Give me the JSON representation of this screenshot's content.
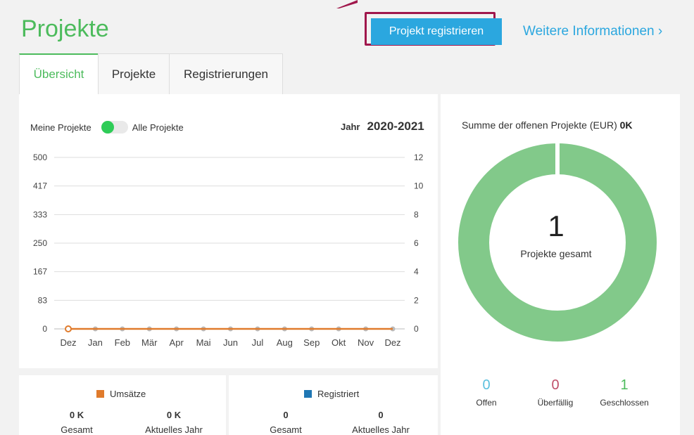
{
  "header": {
    "title": "Projekte",
    "primary_button": "Projekt registrieren",
    "more_link": "Weitere Informationen ›"
  },
  "tabs": [
    {
      "label": "Übersicht",
      "active": true
    },
    {
      "label": "Projekte",
      "active": false
    },
    {
      "label": "Registrierungen",
      "active": false
    }
  ],
  "overview": {
    "toggle_left": "Meine Projekte",
    "toggle_right": "Alle Projekte",
    "year_label": "Jahr",
    "year_value": "2020-2021"
  },
  "chart_data": {
    "type": "line",
    "categories": [
      "Dez",
      "Jan",
      "Feb",
      "Mär",
      "Apr",
      "Mai",
      "Jun",
      "Jul",
      "Aug",
      "Sep",
      "Okt",
      "Nov",
      "Dez"
    ],
    "y_left_ticks": [
      "500",
      "417",
      "333",
      "250",
      "167",
      "83",
      "0"
    ],
    "y_right_ticks": [
      "12",
      "10",
      "8",
      "6",
      "4",
      "2",
      "0"
    ],
    "ylim_left": [
      0,
      500
    ],
    "ylim_right": [
      0,
      12
    ],
    "grid": true,
    "series": [
      {
        "name": "Umsätze",
        "color": "#e07b2c",
        "values": [
          0,
          0,
          0,
          0,
          0,
          0,
          0,
          0,
          0,
          0,
          0,
          0,
          0
        ]
      },
      {
        "name": "Registriert",
        "color": "#1f77b4",
        "values": [
          0,
          0,
          0,
          0,
          0,
          0,
          0,
          0,
          0,
          0,
          0,
          0,
          0
        ]
      }
    ]
  },
  "stats": {
    "umsaetze": {
      "legend": "Umsätze",
      "color": "#e07b2c",
      "total_value": "0 K",
      "total_label": "Gesamt",
      "year_value": "0 K",
      "year_label": "Aktuelles Jahr"
    },
    "registriert": {
      "legend": "Registriert",
      "color": "#1f77b4",
      "total_value": "0",
      "total_label": "Gesamt",
      "year_value": "0",
      "year_label": "Aktuelles Jahr"
    }
  },
  "summary": {
    "title": "Summe der offenen Projekte (EUR)",
    "amount": "0K",
    "total_number": "1",
    "total_label": "Projekte gesamt",
    "ring_color": "#82c98a"
  },
  "status": [
    {
      "value": "0",
      "label": "Offen",
      "color": "#5bc0de"
    },
    {
      "value": "0",
      "label": "Überfällig",
      "color": "#c0506a"
    },
    {
      "value": "1",
      "label": "Geschlossen",
      "color": "#4cbb5c"
    }
  ]
}
